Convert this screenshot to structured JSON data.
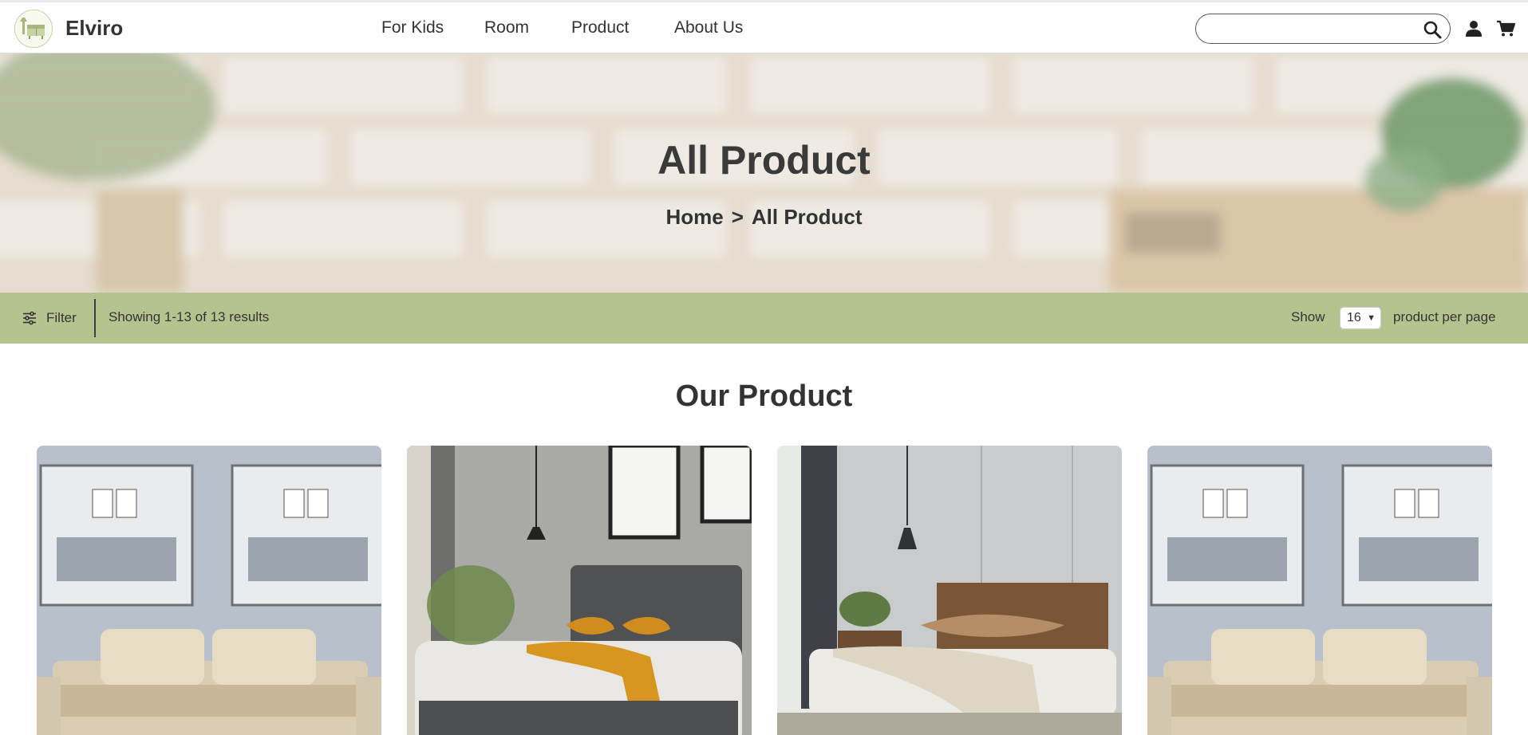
{
  "brand": {
    "name": "Elviro",
    "accent": "#b5c38f"
  },
  "nav": [
    {
      "label": "For Kids"
    },
    {
      "label": "Room"
    },
    {
      "label": "Product"
    },
    {
      "label": "About Us"
    }
  ],
  "search": {
    "placeholder": "",
    "value": "",
    "icon": "search-icon"
  },
  "header_icons": [
    "user-icon",
    "cart-icon"
  ],
  "hero": {
    "title": "All Product",
    "breadcrumb": [
      {
        "label": "Home"
      },
      {
        "label": "All Product"
      }
    ],
    "separator": ">"
  },
  "toolbar": {
    "filter_label": "Filter",
    "filter_icon": "sliders-icon",
    "results_text": "Showing 1-13 of 13 results",
    "show_label": "Show",
    "per_page_value": "16",
    "per_page_suffix": "product per page"
  },
  "products": {
    "heading": "Our Product",
    "items": [
      {
        "image": "sofa-bed-image"
      },
      {
        "image": "upholstered-bed-image"
      },
      {
        "image": "wooden-bed-image"
      },
      {
        "image": "sofa-bed-image"
      }
    ]
  }
}
